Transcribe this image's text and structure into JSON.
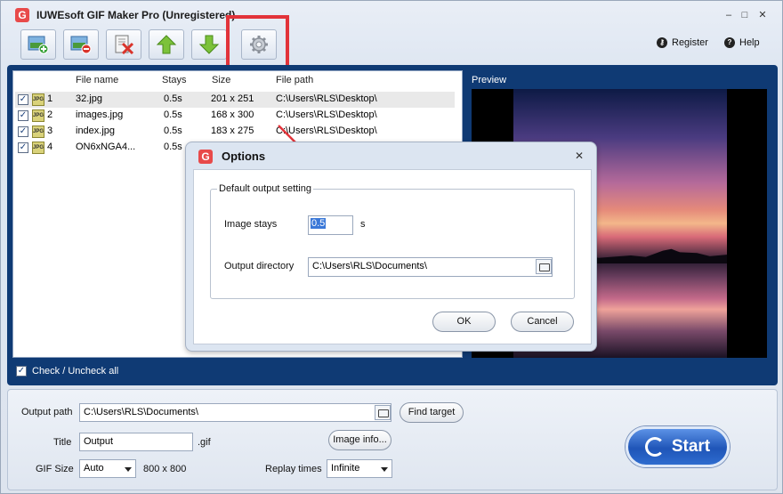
{
  "window": {
    "title": "IUWEsoft GIF Maker Pro (Unregistered)",
    "app_glyph": "G",
    "min": "–",
    "max": "□",
    "close": "✕"
  },
  "topbar": {
    "register": "Register",
    "help": "Help"
  },
  "toolbar": [
    {
      "name": "add-image-button",
      "icon": "add-image-icon"
    },
    {
      "name": "remove-image-button",
      "icon": "remove-image-icon"
    },
    {
      "name": "clear-list-button",
      "icon": "clear-list-icon"
    },
    {
      "name": "move-up-button",
      "icon": "arrow-up-icon"
    },
    {
      "name": "move-down-button",
      "icon": "arrow-down-icon"
    },
    {
      "name": "options-button",
      "icon": "gear-icon"
    }
  ],
  "filelist": {
    "headers": {
      "name": "File name",
      "stays": "Stays",
      "size": "Size",
      "path": "File path"
    },
    "rows": [
      {
        "index": "1",
        "name": "32.jpg",
        "stays": "0.5s",
        "size": "201 x 251",
        "path": "C:\\Users\\RLS\\Desktop\\"
      },
      {
        "index": "2",
        "name": "images.jpg",
        "stays": "0.5s",
        "size": "168 x 300",
        "path": "C:\\Users\\RLS\\Desktop\\"
      },
      {
        "index": "3",
        "name": "index.jpg",
        "stays": "0.5s",
        "size": "183 x 275",
        "path": "C:\\Users\\RLS\\Desktop\\"
      },
      {
        "index": "4",
        "name": "ON6xNGA4...",
        "stays": "0.5s",
        "size": "",
        "path": ""
      }
    ],
    "check_all": "Check / Uncheck all"
  },
  "preview": {
    "label": "Preview"
  },
  "bottom": {
    "output_path_label": "Output path",
    "output_path": "C:\\Users\\RLS\\Documents\\",
    "find_target": "Find target",
    "title_label": "Title",
    "title_value": "Output",
    "title_ext": ".gif",
    "image_info": "Image info...",
    "gif_size_label": "GIF Size",
    "gif_size_value": "Auto",
    "gif_size_dims": "800 x 800",
    "replay_label": "Replay times",
    "replay_value": "Infinite",
    "start": "Start"
  },
  "dialog": {
    "title": "Options",
    "close": "✕",
    "group": "Default output setting",
    "image_stays_label": "Image stays",
    "image_stays_value": "0.5",
    "image_stays_unit": "s",
    "output_dir_label": "Output directory",
    "output_dir_value": "C:\\Users\\RLS\\Documents\\",
    "ok": "OK",
    "cancel": "Cancel"
  },
  "colors": {
    "accent_red": "#e2333a",
    "work_blue": "#0f3a74",
    "start_blue": "#1f55b8"
  }
}
